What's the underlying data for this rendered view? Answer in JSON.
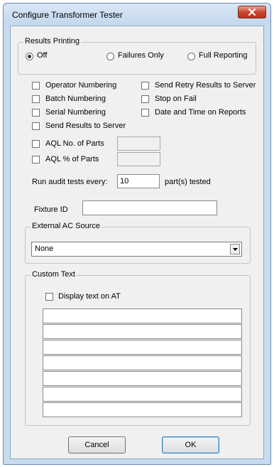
{
  "window": {
    "title": "Configure Transformer Tester"
  },
  "results_printing": {
    "label": "Results Printing",
    "options": [
      {
        "label": "Off",
        "selected": true
      },
      {
        "label": "Failures Only",
        "selected": false
      },
      {
        "label": "Full Reporting",
        "selected": false
      }
    ]
  },
  "options": {
    "operator_numbering": {
      "label": "Operator Numbering",
      "checked": false
    },
    "send_retry_results": {
      "label": "Send Retry Results to Server",
      "checked": false
    },
    "batch_numbering": {
      "label": "Batch Numbering",
      "checked": false
    },
    "stop_on_fail": {
      "label": "Stop on Fail",
      "checked": false
    },
    "serial_numbering": {
      "label": "Serial Numbering",
      "checked": false
    },
    "date_time_reports": {
      "label": "Date and Time on Reports",
      "checked": false
    },
    "send_results_server": {
      "label": "Send Results to Server",
      "checked": false
    },
    "aql_no_parts": {
      "label": "AQL No. of Parts",
      "checked": false,
      "value": ""
    },
    "aql_pct_parts": {
      "label": "AQL % of Parts",
      "checked": false,
      "value": ""
    }
  },
  "audit": {
    "prefix": "Run audit tests every:",
    "value": "10",
    "suffix": "part(s) tested"
  },
  "fixture": {
    "label": "Fixture ID",
    "value": ""
  },
  "ac_source": {
    "label": "External AC Source",
    "selected": "None"
  },
  "custom_text": {
    "label": "Custom Text",
    "display_text": {
      "label": "Display text on AT",
      "checked": false
    },
    "lines": [
      "",
      "",
      "",
      "",
      "",
      "",
      ""
    ]
  },
  "buttons": {
    "cancel": "Cancel",
    "ok": "OK"
  }
}
